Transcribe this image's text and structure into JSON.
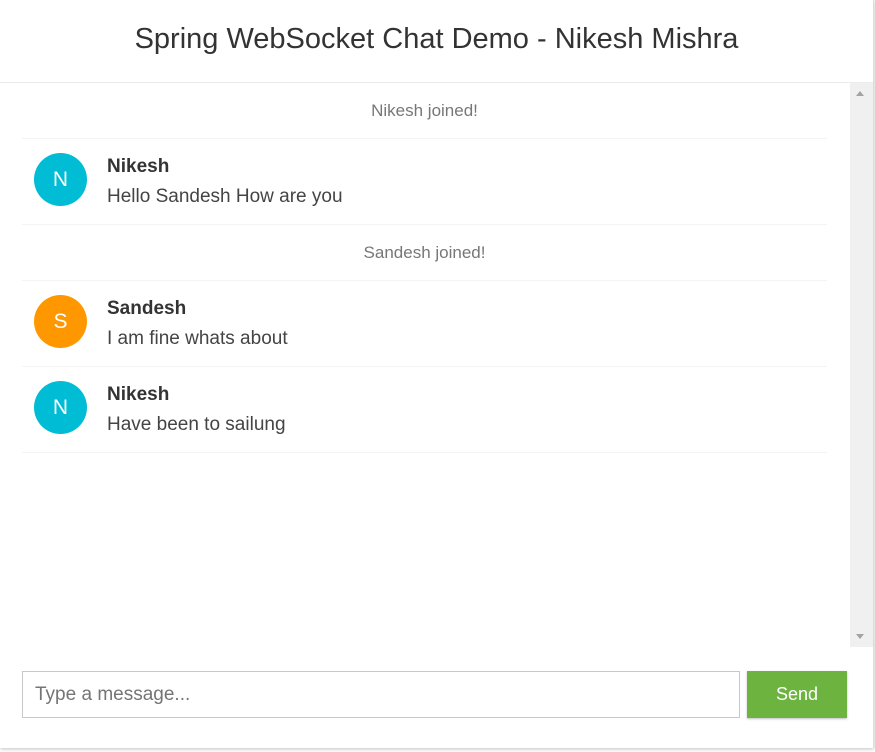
{
  "header": {
    "title": "Spring WebSocket Chat Demo - Nikesh Mishra"
  },
  "colors": {
    "avatar_nikesh": "#00bcd4",
    "avatar_sandesh": "#ff9800",
    "send_button": "#6db33f"
  },
  "messages": [
    {
      "type": "event",
      "text": "Nikesh joined!"
    },
    {
      "type": "chat",
      "avatar_letter": "N",
      "sender": "Nikesh",
      "text": "Hello Sandesh How are you"
    },
    {
      "type": "event",
      "text": "Sandesh joined!"
    },
    {
      "type": "chat",
      "avatar_letter": "S",
      "sender": "Sandesh",
      "text": "I am fine whats about"
    },
    {
      "type": "chat",
      "avatar_letter": "N",
      "sender": "Nikesh",
      "text": "Have been to sailung"
    }
  ],
  "form": {
    "placeholder": "Type a message...",
    "value": "",
    "send_label": "Send"
  }
}
